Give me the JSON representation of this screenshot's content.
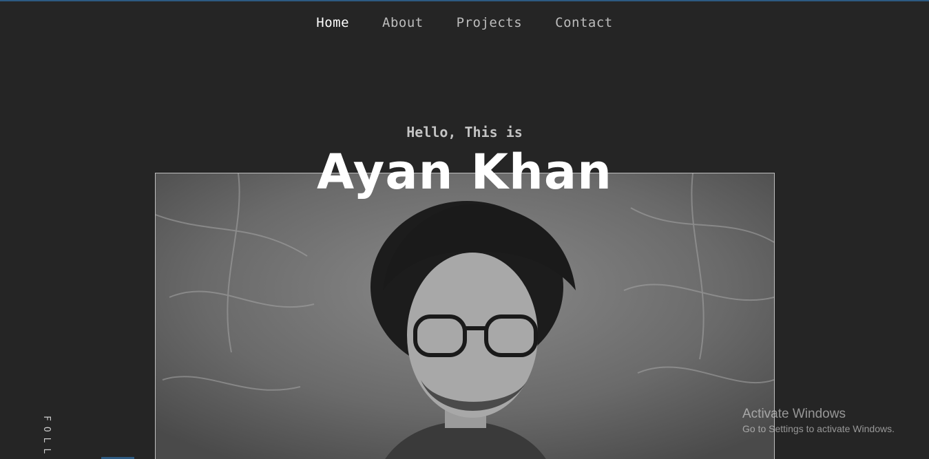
{
  "nav": {
    "items": [
      {
        "label": "Home",
        "active": true
      },
      {
        "label": "About",
        "active": false
      },
      {
        "label": "Projects",
        "active": false
      },
      {
        "label": "Contact",
        "active": false
      }
    ]
  },
  "hero": {
    "greeting": "Hello, This is",
    "name": "Ayan Khan",
    "photo_icon": "portrait-photo"
  },
  "sidebar": {
    "follow_text": "FOLL"
  },
  "watermark": {
    "title": "Activate Windows",
    "subtitle": "Go to Settings to activate Windows."
  },
  "colors": {
    "background": "#252525",
    "accent": "#2d5a82",
    "text_primary": "#ffffff",
    "text_muted": "#bdbdbd"
  }
}
